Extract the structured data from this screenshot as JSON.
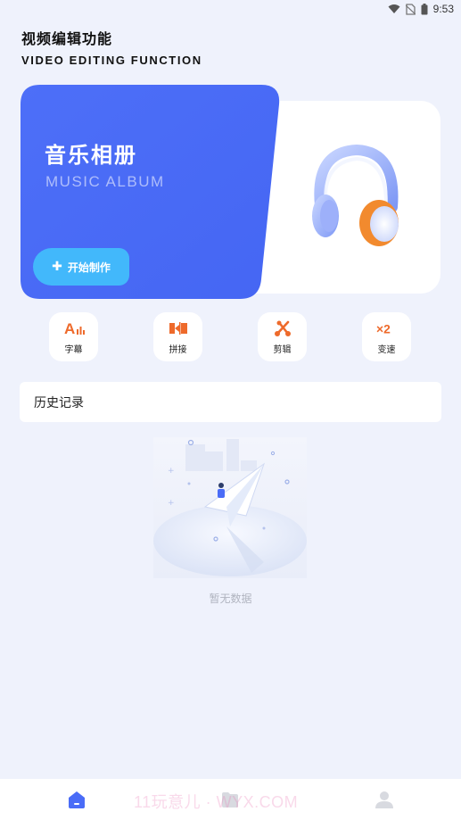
{
  "status_bar": {
    "time": "9:53"
  },
  "header": {
    "title_cn": "视频编辑功能",
    "title_en": "VIDEO EDITING FUNCTION"
  },
  "banner": {
    "title_cn": "音乐相册",
    "title_en": "MUSIC ALBUM",
    "button_label": "开始制作",
    "accent_color": "#4a6cf7",
    "button_color": "#42b8fb"
  },
  "tools": [
    {
      "label": "字幕",
      "icon": "subtitle-icon"
    },
    {
      "label": "拼接",
      "icon": "splice-icon"
    },
    {
      "label": "剪辑",
      "icon": "scissors-icon"
    },
    {
      "label": "变速",
      "icon": "speed-x2-icon"
    }
  ],
  "tool_icon_texts": {
    "subtitle": "A",
    "speed": "×2"
  },
  "history": {
    "title": "历史记录"
  },
  "empty_state": {
    "text": "暂无数据"
  },
  "bottom_nav": {
    "items": [
      {
        "icon": "home-icon",
        "active": true
      },
      {
        "icon": "folder-icon",
        "active": false
      },
      {
        "icon": "profile-icon",
        "active": false
      }
    ],
    "active_color": "#4a6cf7",
    "inactive_color": "#d8dae0"
  },
  "watermark": "11玩意儿 · WYX.COM"
}
